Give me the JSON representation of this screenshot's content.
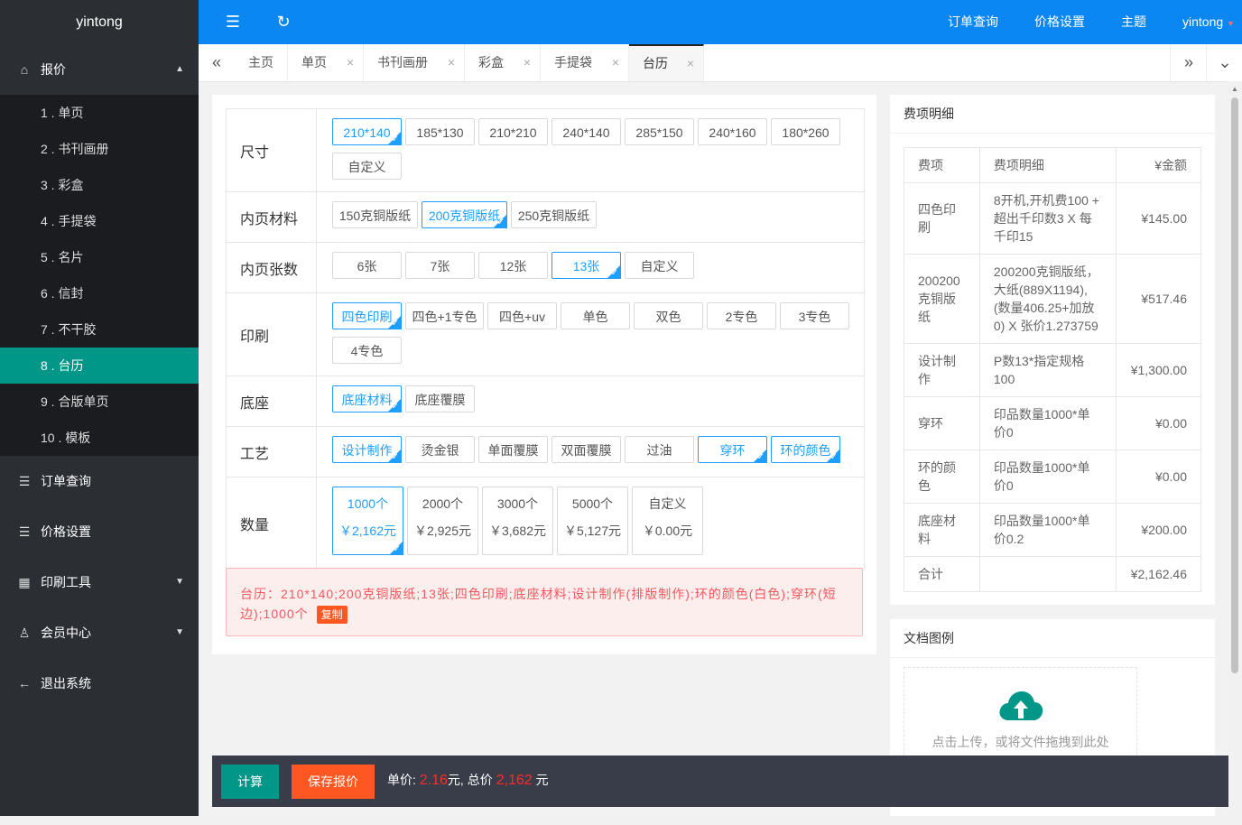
{
  "sidebar": {
    "logo": "yintong",
    "quote_label": "报价",
    "sub_items": [
      "1 . 单页",
      "2 . 书刊画册",
      "3 . 彩盒",
      "4 . 手提袋",
      "5 . 名片",
      "6 . 信封",
      "7 . 不干胶",
      "8 . 台历",
      "9 . 合版单页",
      "10 . 模板"
    ],
    "active_index": 7,
    "orders": "订单查询",
    "pricing": "价格设置",
    "tools": "印刷工具",
    "member": "会员中心",
    "logout": "退出系统"
  },
  "header": {
    "links": [
      "订单查询",
      "价格设置",
      "主题"
    ],
    "user": "yintong"
  },
  "tabs": [
    {
      "label": "主页"
    },
    {
      "label": "单页"
    },
    {
      "label": "书刊画册"
    },
    {
      "label": "彩盒"
    },
    {
      "label": "手提袋"
    },
    {
      "label": "台历"
    }
  ],
  "options": {
    "size": {
      "label": "尺寸",
      "items": [
        "210*140",
        "185*130",
        "210*210",
        "240*140",
        "285*150",
        "240*160",
        "180*260",
        "自定义"
      ],
      "selected": [
        0
      ]
    },
    "paper": {
      "label": "内页材料",
      "items": [
        "150克铜版纸",
        "200克铜版纸",
        "250克铜版纸"
      ],
      "selected": [
        1
      ]
    },
    "sheets": {
      "label": "内页张数",
      "items": [
        "6张",
        "7张",
        "12张",
        "13张",
        "自定义"
      ],
      "selected": [
        3
      ]
    },
    "print": {
      "label": "印刷",
      "items": [
        "四色印刷",
        "四色+1专色",
        "四色+uv",
        "单色",
        "双色",
        "2专色",
        "3专色",
        "4专色"
      ],
      "selected": [
        0
      ]
    },
    "base": {
      "label": "底座",
      "items": [
        "底座材料",
        "底座覆膜"
      ],
      "selected": [
        0
      ]
    },
    "craft": {
      "label": "工艺",
      "items": [
        "设计制作",
        "烫金银",
        "单面覆膜",
        "双面覆膜",
        "过油",
        "穿环",
        "环的颜色"
      ],
      "selected": [
        0,
        5,
        6
      ]
    },
    "quantity": {
      "label": "数量",
      "items": [
        {
          "qty": "1000个",
          "price": "￥2,162元"
        },
        {
          "qty": "2000个",
          "price": "￥2,925元"
        },
        {
          "qty": "3000个",
          "price": "￥3,682元"
        },
        {
          "qty": "5000个",
          "price": "￥5,127元"
        },
        {
          "qty": "自定义",
          "price": "￥0.00元"
        }
      ],
      "selected": [
        0
      ]
    }
  },
  "summary": {
    "text": "台历：210*140;200克铜版纸;13张;四色印刷;底座材料;设计制作(排版制作);环的颜色(白色);穿环(短边);1000个",
    "copy": "复制"
  },
  "fee": {
    "title": "费项明细",
    "headers": [
      "费项",
      "费项明细",
      "¥金额"
    ],
    "rows": [
      {
        "item": "四色印刷",
        "detail": "8开机,开机费100 + 超出千印数3 X 每千印15",
        "amount": "¥145.00"
      },
      {
        "item": "200200克铜版纸",
        "detail": "200200克铜版纸，大纸(889X1194),(数量406.25+加放0) X 张价1.273759",
        "amount": "¥517.46"
      },
      {
        "item": "设计制作",
        "detail": "P数13*指定规格100",
        "amount": "¥1,300.00"
      },
      {
        "item": "穿环",
        "detail": "印品数量1000*单价0",
        "amount": "¥0.00"
      },
      {
        "item": "环的颜色",
        "detail": "印品数量1000*单价0",
        "amount": "¥0.00"
      },
      {
        "item": "底座材料",
        "detail": "印品数量1000*单价0.2",
        "amount": "¥200.00"
      },
      {
        "item": "合计",
        "detail": "",
        "amount": "¥2,162.46"
      }
    ]
  },
  "doc": {
    "title": "文档图例",
    "upload_text": "点击上传，或将文件拖拽到此处"
  },
  "bottom": {
    "calc": "计算",
    "save": "保存报价",
    "unit_label": "单价:",
    "unit_price": "2.16",
    "yuan": "元,",
    "total_label": "总价",
    "total_price": "2,162",
    "yuan2": "元"
  },
  "colors": {
    "primary": "#0b87f4",
    "active": "#009688",
    "select": "#1e9fff",
    "danger": "#ff5722"
  }
}
